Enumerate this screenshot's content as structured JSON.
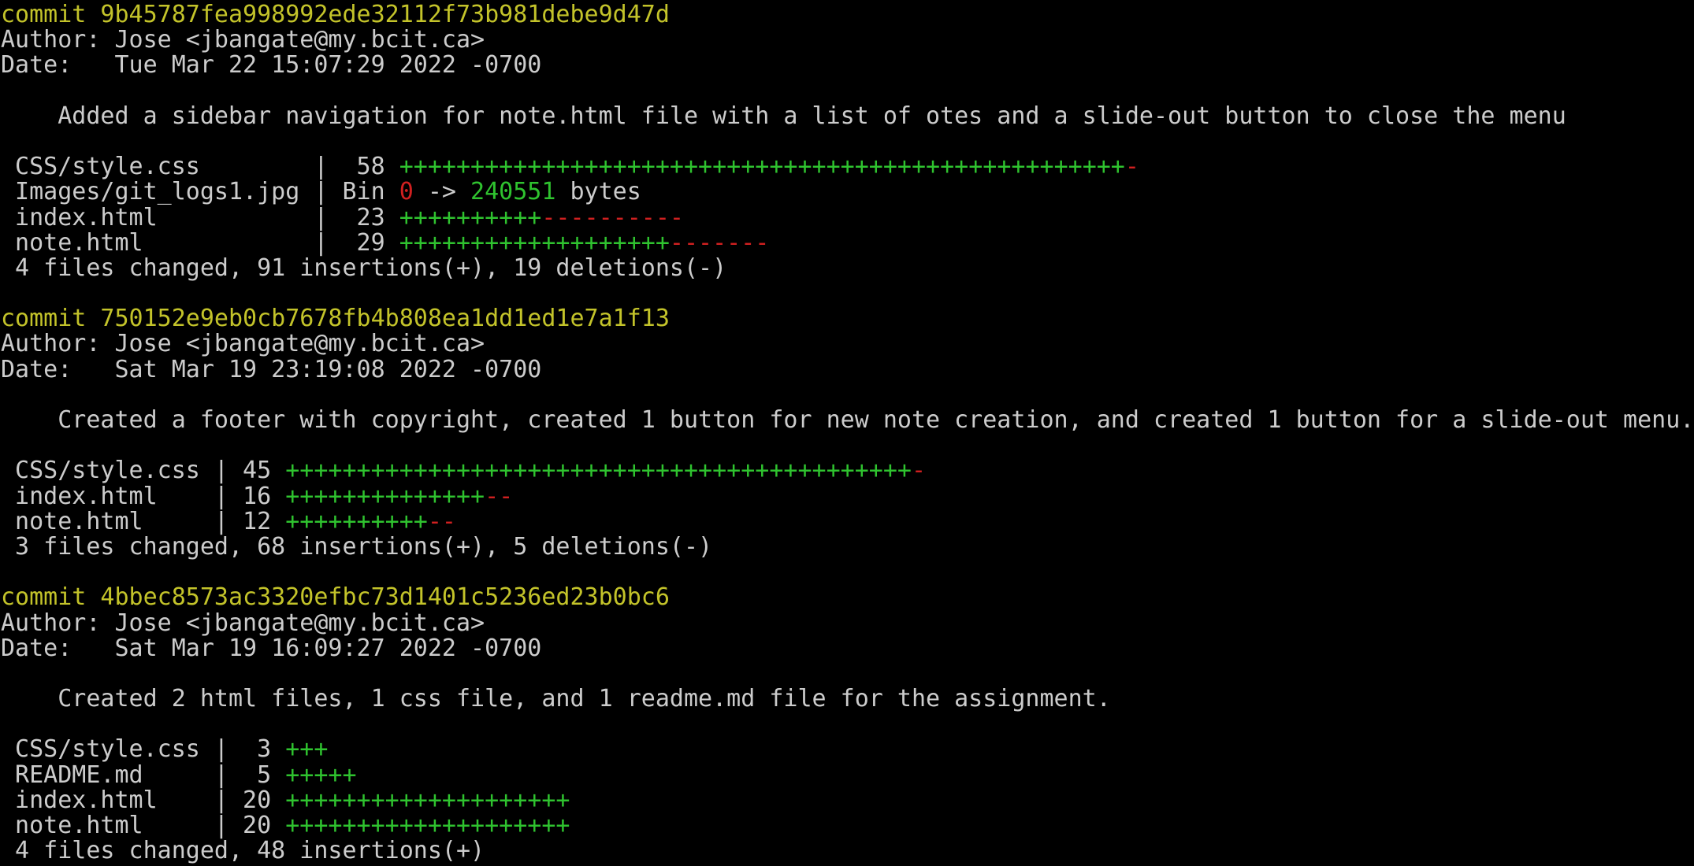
{
  "colors": {
    "background": "#000000",
    "text": "#cccccc",
    "commit_hash": "#c3c32a",
    "insertions": "#2fc32f",
    "deletions": "#d02020"
  },
  "lines": [
    {
      "kind": "commit",
      "segments": [
        {
          "t": "commit 9b45787fea998992ede32112f73b981debe9d47d",
          "c": "commit"
        }
      ]
    },
    {
      "kind": "author",
      "segments": [
        {
          "t": "Author: Jose <jbangate@my.bcit.ca>",
          "c": "default"
        }
      ]
    },
    {
      "kind": "date",
      "segments": [
        {
          "t": "Date:   Tue Mar 22 15:07:29 2022 -0700",
          "c": "default"
        }
      ]
    },
    {
      "kind": "blank",
      "segments": []
    },
    {
      "kind": "message",
      "segments": [
        {
          "t": "    Added a sidebar navigation for note.html file with a list of otes and a slide-out button to close the menu",
          "c": "default"
        }
      ]
    },
    {
      "kind": "blank",
      "segments": []
    },
    {
      "kind": "stat",
      "segments": [
        {
          "t": " CSS/style.css        |  58 ",
          "c": "default"
        },
        {
          "t": "+++++++++++++++++++++++++++++++++++++++++++++++++++",
          "c": "green"
        },
        {
          "t": "-",
          "c": "red"
        }
      ]
    },
    {
      "kind": "stat",
      "segments": [
        {
          "t": " Images/git_logs1.jpg | Bin ",
          "c": "default"
        },
        {
          "t": "0",
          "c": "red"
        },
        {
          "t": " -> ",
          "c": "default"
        },
        {
          "t": "240551",
          "c": "green"
        },
        {
          "t": " bytes",
          "c": "default"
        }
      ]
    },
    {
      "kind": "stat",
      "segments": [
        {
          "t": " index.html           |  23 ",
          "c": "default"
        },
        {
          "t": "++++++++++",
          "c": "green"
        },
        {
          "t": "----------",
          "c": "red"
        }
      ]
    },
    {
      "kind": "stat",
      "segments": [
        {
          "t": " note.html            |  29 ",
          "c": "default"
        },
        {
          "t": "+++++++++++++++++++",
          "c": "green"
        },
        {
          "t": "-------",
          "c": "red"
        }
      ]
    },
    {
      "kind": "summary",
      "segments": [
        {
          "t": " 4 files changed, 91 insertions(+), 19 deletions(-)",
          "c": "default"
        }
      ]
    },
    {
      "kind": "blank",
      "segments": []
    },
    {
      "kind": "commit",
      "segments": [
        {
          "t": "commit 750152e9eb0cb7678fb4b808ea1dd1ed1e7a1f13",
          "c": "commit"
        }
      ]
    },
    {
      "kind": "author",
      "segments": [
        {
          "t": "Author: Jose <jbangate@my.bcit.ca>",
          "c": "default"
        }
      ]
    },
    {
      "kind": "date",
      "segments": [
        {
          "t": "Date:   Sat Mar 19 23:19:08 2022 -0700",
          "c": "default"
        }
      ]
    },
    {
      "kind": "blank",
      "segments": []
    },
    {
      "kind": "message",
      "segments": [
        {
          "t": "    Created a footer with copyright, created 1 button for new note creation, and created 1 button for a slide-out menu.",
          "c": "default"
        }
      ]
    },
    {
      "kind": "blank",
      "segments": []
    },
    {
      "kind": "stat",
      "segments": [
        {
          "t": " CSS/style.css | 45 ",
          "c": "default"
        },
        {
          "t": "++++++++++++++++++++++++++++++++++++++++++++",
          "c": "green"
        },
        {
          "t": "-",
          "c": "red"
        }
      ]
    },
    {
      "kind": "stat",
      "segments": [
        {
          "t": " index.html    | 16 ",
          "c": "default"
        },
        {
          "t": "++++++++++++++",
          "c": "green"
        },
        {
          "t": "--",
          "c": "red"
        }
      ]
    },
    {
      "kind": "stat",
      "segments": [
        {
          "t": " note.html     | 12 ",
          "c": "default"
        },
        {
          "t": "++++++++++",
          "c": "green"
        },
        {
          "t": "--",
          "c": "red"
        }
      ]
    },
    {
      "kind": "summary",
      "segments": [
        {
          "t": " 3 files changed, 68 insertions(+), 5 deletions(-)",
          "c": "default"
        }
      ]
    },
    {
      "kind": "blank",
      "segments": []
    },
    {
      "kind": "commit",
      "segments": [
        {
          "t": "commit 4bbec8573ac3320efbc73d1401c5236ed23b0bc6",
          "c": "commit"
        }
      ]
    },
    {
      "kind": "author",
      "segments": [
        {
          "t": "Author: Jose <jbangate@my.bcit.ca>",
          "c": "default"
        }
      ]
    },
    {
      "kind": "date",
      "segments": [
        {
          "t": "Date:   Sat Mar 19 16:09:27 2022 -0700",
          "c": "default"
        }
      ]
    },
    {
      "kind": "blank",
      "segments": []
    },
    {
      "kind": "message",
      "segments": [
        {
          "t": "    Created 2 html files, 1 css file, and 1 readme.md file for the assignment.",
          "c": "default"
        }
      ]
    },
    {
      "kind": "blank",
      "segments": []
    },
    {
      "kind": "stat",
      "segments": [
        {
          "t": " CSS/style.css |  3 ",
          "c": "default"
        },
        {
          "t": "+++",
          "c": "green"
        }
      ]
    },
    {
      "kind": "stat",
      "segments": [
        {
          "t": " README.md     |  5 ",
          "c": "default"
        },
        {
          "t": "+++++",
          "c": "green"
        }
      ]
    },
    {
      "kind": "stat",
      "segments": [
        {
          "t": " index.html    | 20 ",
          "c": "default"
        },
        {
          "t": "++++++++++++++++++++",
          "c": "green"
        }
      ]
    },
    {
      "kind": "stat",
      "segments": [
        {
          "t": " note.html     | 20 ",
          "c": "default"
        },
        {
          "t": "++++++++++++++++++++",
          "c": "green"
        }
      ]
    },
    {
      "kind": "summary",
      "segments": [
        {
          "t": " 4 files changed, 48 insertions(+)",
          "c": "default"
        }
      ]
    }
  ]
}
